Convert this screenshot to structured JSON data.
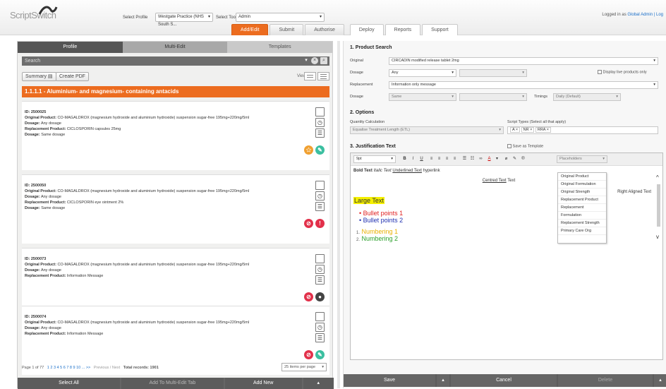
{
  "header": {
    "logo_text": "ScriptSwitch",
    "select_profile_label": "Select Profile",
    "select_profile_value": "Westgate Practice (NHS South S...",
    "select_tool_label": "Select Tool",
    "select_tool_value": "Admin",
    "login_prefix": "Logged in as",
    "login_user": "Global Admin | Log",
    "nav_tabs": [
      "Add/Edit",
      "Submit",
      "Authorise",
      "Deploy",
      "Reports",
      "Support"
    ]
  },
  "left": {
    "tabs": [
      "Profile",
      "Multi-Edit",
      "Templates"
    ],
    "search_placeholder": "Search",
    "summary_label": "Summary",
    "create_pdf_label": "Create PDF",
    "view_label": "View",
    "section_title": "1.1.1.1 - Aluminium- and magnesium- containing antacids",
    "cards": [
      {
        "id": "ID: 2500025",
        "original": "CO-MAGALDROX (magnesium hydroxide and aluminium hydroxide) suspension sugar-free 195mg+220mg/5ml",
        "dosage": "Any dosage",
        "replacement": "CICLOSPORIN capsules 25mg",
        "rdosage": "Same dosage"
      },
      {
        "id": "ID: 2500050",
        "original": "CO-MAGALDROX (magnesium hydroxide and aluminium hydroxide) suspension sugar-free 195mg+220mg/5ml",
        "dosage": "Any dosage",
        "replacement": "CICLOSPORIN eye ointment 2%",
        "rdosage": "Same dosage"
      },
      {
        "id": "ID: 2500073",
        "original": "CO-MAGALDROX (magnesium hydroxide and aluminium hydroxide) suspension sugar-free 195mg+220mg/5ml",
        "dosage": "Any dosage",
        "replacement": "Information Message",
        "rdosage": ""
      },
      {
        "id": "ID: 2500074",
        "original": "CO-MAGALDROX (magnesium hydroxide and aluminium hydroxide) suspension sugar-free 195mg+220mg/5ml",
        "dosage": "Any dosage",
        "replacement": "Information Message",
        "rdosage": ""
      }
    ],
    "labels": {
      "id_prefix": "",
      "original": "Original Product:",
      "dosage": "Dosage:",
      "replacement": "Replacement Product:",
      "rdosage": "Dosage:"
    },
    "pager": {
      "page": "Page 1 of 77",
      "pages": "1 2 3 4 5 6 7 8 9 10 ... >>",
      "prevnext": "Previous / Next",
      "total": "Total records: 1901",
      "per_page": "25 items per page"
    },
    "bottom_buttons": [
      "Select All",
      "Add To Multi-Edit Tab",
      "Add New"
    ]
  },
  "right": {
    "s1_title": "1. Product Search",
    "original_label": "Original",
    "original_value": "CIRCADIN modified release tablet 2mg",
    "dosage_label": "Dosage",
    "dosage_value": "Any",
    "display_live": "Display live products only",
    "replacement_label": "Replacement",
    "replacement_value": "Information only message",
    "dosage2_label": "Dosage",
    "dosage2_value": "Same",
    "timings_label": "Timings",
    "timings_value": "Daily (Default)",
    "s2_title": "2. Options",
    "qty_label": "Quantity Calculation",
    "qty_value": "Equalise Treatment Length (ETL)",
    "script_types_label": "Script Types (Select all that apply)",
    "script_types": [
      "A ×",
      "NR ×",
      "RRA ×"
    ],
    "s3_title": "3. Justification Text",
    "save_template": "Save as Template",
    "font_size": "9pt",
    "placeholders_label": "Placeholders",
    "placeholders": [
      "Original Product",
      "Original Formulation",
      "Original Strength",
      "Replacement Product",
      "Replacement",
      "Formulation",
      "Replacement Strength",
      "Primary Care Org"
    ],
    "editor": {
      "line1_bold": "Bold Text",
      "line1_italic": "Italic Text",
      "line1_underline": "Underlined Text",
      "line1_link": "hyperlink",
      "centred": "Centred Text",
      "right_aligned": "Right Aligned Text",
      "large": "Large Text",
      "bullet1": "Bullet points 1",
      "bullet2": "Bullet points 2",
      "num1": "Numbering 1",
      "num2": "Numbering 2"
    },
    "bottom_buttons": [
      "Save",
      "Cancel",
      "Delete"
    ]
  },
  "colors": {
    "accent": "#ec6c1f",
    "link": "#1a6fc9",
    "bullet1": "#e02020",
    "bullet2": "#2030b0",
    "num1": "#e8b000",
    "num2": "#2ca02c",
    "highlight": "#f5f000"
  }
}
